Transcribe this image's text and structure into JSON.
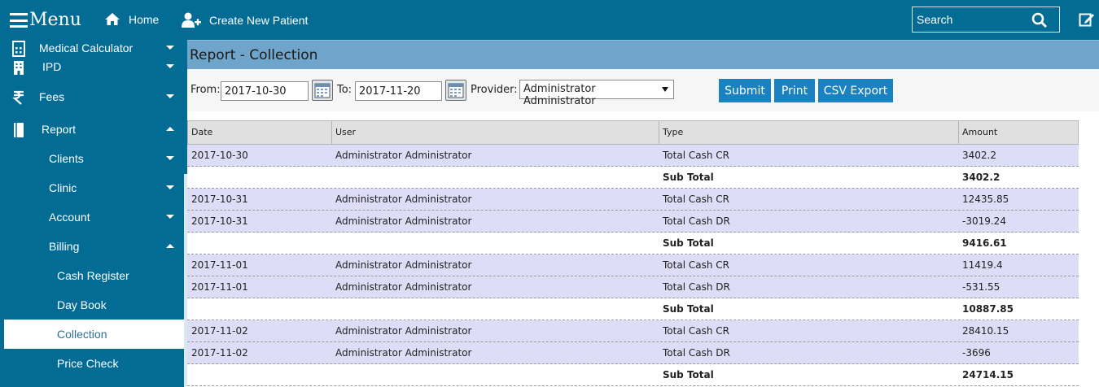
{
  "topbar": {
    "menu_label": "Menu",
    "home_label": "Home",
    "create_patient_label": "Create New Patient",
    "search_placeholder": "Search"
  },
  "sidebar": {
    "items": [
      {
        "label": "Medical Calculator",
        "icon": "calculator-icon",
        "caret": "down"
      },
      {
        "label": "IPD",
        "icon": "building-icon",
        "caret": "down"
      },
      {
        "label": "Fees",
        "icon": "rupee-icon",
        "caret": "down"
      },
      {
        "label": "Report",
        "icon": "book-icon",
        "caret": "up"
      },
      {
        "label": "Clients",
        "caret": "down"
      },
      {
        "label": "Clinic",
        "caret": "down"
      },
      {
        "label": "Account",
        "caret": "down"
      },
      {
        "label": "Billing",
        "caret": "up"
      },
      {
        "label": "Cash Register"
      },
      {
        "label": "Day Book"
      },
      {
        "label": "Collection",
        "active": true
      },
      {
        "label": "Price Check"
      }
    ]
  },
  "page": {
    "title": "Report - Collection"
  },
  "filters": {
    "from_label": "From:",
    "from_value": "2017-10-30",
    "to_label": "To:",
    "to_value": "2017-11-20",
    "provider_label": "Provider:",
    "provider_value": "Administrator Administrator",
    "submit_label": "Submit",
    "print_label": "Print",
    "csv_label": "CSV Export"
  },
  "table": {
    "headers": [
      "Date",
      "User",
      "Type",
      "Amount"
    ],
    "rows": [
      {
        "kind": "data",
        "date": "2017-10-30",
        "user": "Administrator Administrator",
        "type": "Total Cash CR",
        "amount": "3402.2"
      },
      {
        "kind": "sub",
        "date": "",
        "user": "",
        "type": "Sub Total",
        "amount": "3402.2"
      },
      {
        "kind": "data",
        "date": "2017-10-31",
        "user": "Administrator Administrator",
        "type": "Total Cash CR",
        "amount": "12435.85"
      },
      {
        "kind": "data",
        "date": "2017-10-31",
        "user": "Administrator Administrator",
        "type": "Total Cash DR",
        "amount": "-3019.24"
      },
      {
        "kind": "sub",
        "date": "",
        "user": "",
        "type": "Sub Total",
        "amount": "9416.61"
      },
      {
        "kind": "data",
        "date": "2017-11-01",
        "user": "Administrator Administrator",
        "type": "Total Cash CR",
        "amount": "11419.4"
      },
      {
        "kind": "data",
        "date": "2017-11-01",
        "user": "Administrator Administrator",
        "type": "Total Cash DR",
        "amount": "-531.55"
      },
      {
        "kind": "sub",
        "date": "",
        "user": "",
        "type": "Sub Total",
        "amount": "10887.85"
      },
      {
        "kind": "data",
        "date": "2017-11-02",
        "user": "Administrator Administrator",
        "type": "Total Cash CR",
        "amount": "28410.15"
      },
      {
        "kind": "data",
        "date": "2017-11-02",
        "user": "Administrator Administrator",
        "type": "Total Cash DR",
        "amount": "-3696"
      },
      {
        "kind": "sub",
        "date": "",
        "user": "",
        "type": "Sub Total",
        "amount": "24714.15"
      }
    ]
  },
  "colors": {
    "primary": "#026c95",
    "header_bar": "#6fa4cb",
    "button": "#1a82c0",
    "row_highlight": "#ddddf7"
  }
}
